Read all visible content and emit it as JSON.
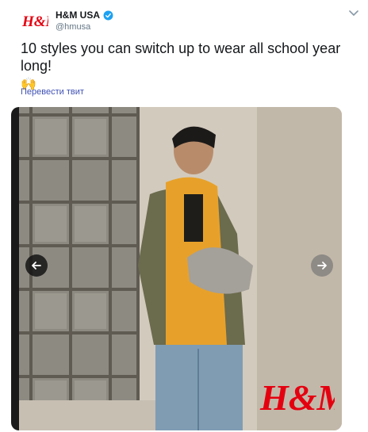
{
  "account": {
    "display_name": "H&M USA",
    "handle": "@hmusa",
    "avatar_logo_text": "H&M",
    "verified": true
  },
  "tweet": {
    "text": "10 styles you can switch up to wear all school year long!",
    "emoji": "🙌",
    "translate_label": "Перевести твит"
  },
  "media": {
    "watermark_logo_text": "H&M"
  },
  "colors": {
    "brand_red": "#e50010",
    "verified_blue": "#1da1f2",
    "link_color": "#3f51b5",
    "text_secondary": "#657786"
  },
  "icons": {
    "more_menu": "chevron-down-icon",
    "verified": "verified-badge-icon",
    "prev": "arrow-left-icon",
    "next": "arrow-right-icon"
  }
}
